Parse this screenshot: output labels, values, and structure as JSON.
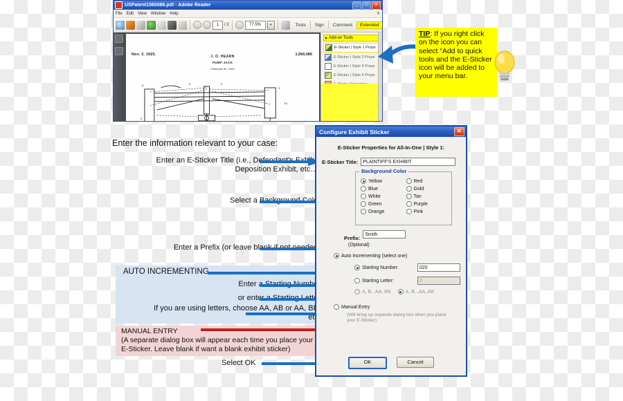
{
  "reader": {
    "title": "USPatent1560086.pdf - Adobe Reader",
    "window_buttons": [
      "_",
      "□",
      "✕"
    ],
    "menus": [
      "File",
      "Edit",
      "View",
      "Window",
      "Help"
    ],
    "menu_close": "✕",
    "toolbar": {
      "page_current": "1",
      "page_total": "/ 2",
      "zoom": "77.5%",
      "zoom_arrow": "▾",
      "right_labels": [
        "Tools",
        "Sign",
        "Comment"
      ],
      "extended_label": "Extended"
    },
    "document": {
      "date": "Nov. 3, 1925.",
      "patent_number": "1,560,086",
      "inventor": "J. O. HEARN",
      "title": "PUMP JACK",
      "filed": "Filed April 30, 1923"
    },
    "addon_panel": {
      "header": "Add-on Tools",
      "items": [
        {
          "label": "E-Sticker | Style 1 Props",
          "icon": "sticker-style1-icon"
        },
        {
          "label": "E-Sticker | Style 2 Props",
          "icon": "sticker-style2-icon"
        },
        {
          "label": "E-Sticker | Style 3 Props",
          "icon": "sticker-style3-icon"
        },
        {
          "label": "E-Sticker | Style 4 Props",
          "icon": "sticker-style4-icon"
        },
        {
          "label": "E-Sticker Properties",
          "icon": "sticker-properties-icon"
        }
      ]
    }
  },
  "tip": {
    "label": "TIP",
    "text": ": If you right click on the icon you can select “Add to quick tools and the E-Sticker icon will be added to your menu bar."
  },
  "dialog": {
    "title": "Configure Exhibit Sticker",
    "close": "✕",
    "header": "E-Sticker Properties for All-In-One | Style 1:",
    "title_label": "E-Sticker Title:",
    "title_value": "PLAINTIFF'S EXHIBIT",
    "bg_legend": "Background Color",
    "bg_colors": [
      {
        "label": "Yellow",
        "selected": true
      },
      {
        "label": "Red",
        "selected": false
      },
      {
        "label": "Blue",
        "selected": false
      },
      {
        "label": "Gold",
        "selected": false
      },
      {
        "label": "White",
        "selected": false
      },
      {
        "label": "Tan",
        "selected": false
      },
      {
        "label": "Green",
        "selected": false
      },
      {
        "label": "Purple",
        "selected": false
      },
      {
        "label": "Orange",
        "selected": false
      },
      {
        "label": "Pink",
        "selected": false
      }
    ],
    "prefix_label": "Prefix:",
    "prefix_value": "Smith",
    "optional_note": "(Optional)",
    "auto_label": "Auto Incrementing (select one)",
    "starting_number_label": "Starting Number:",
    "starting_number_value": "020",
    "starting_letter_label": "Starting Letter:",
    "starting_letter_value": "0",
    "letter_style_a": "A, B...AA, BB",
    "letter_style_b": "A, B...AA, AB",
    "manual_label": "Manual Entry",
    "manual_note": "(Will bring up separate dialog box when you place your E-Sticker)",
    "ok_label": "OK",
    "cancel_label": "Cancel"
  },
  "annotations": {
    "intro": "Enter the information relevant to your case:",
    "title_field": "Enter an E-Sticker Title (i.e., Defendant's Exhibit, Deposition Exhibit, etc…)",
    "background": "Select a Background Color",
    "prefix": "Enter a Prefix (or leave blank if not needed)",
    "auto_incrementing": "AUTO INCREMENTING",
    "starting_number": "Enter a Starting Number",
    "starting_letter": "or enter a Starting Letter",
    "letters": "If you are using letters, choose AA, AB or AA, BB, etc.",
    "manual_entry_header": "MANUAL ENTRY",
    "manual_entry_body": "(A separate dialog box will appear each time you place your E-Sticker. Leave blank if want a blank exhibit sticker)",
    "select_ok": "Select OK"
  },
  "colors": {
    "accent_blue": "#1d4fa8",
    "arrow_blue": "#1b6fc4",
    "arrow_red": "#c42020",
    "highlight_yellow": "#ffff00",
    "auto_band": "#d7e4f2",
    "manual_band": "#f2d4d4"
  }
}
